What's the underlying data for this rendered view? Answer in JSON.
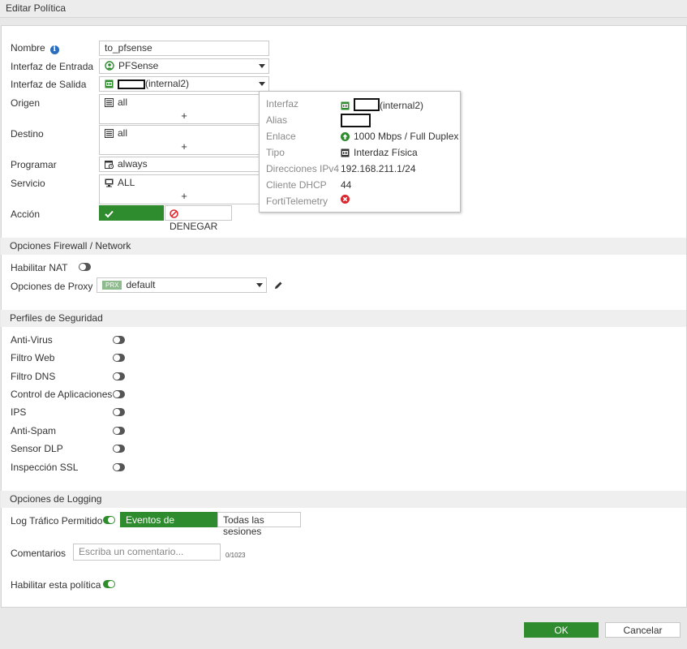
{
  "window": {
    "title": "Editar Política"
  },
  "form": {
    "name": {
      "label": "Nombre",
      "value": "to_pfsense"
    },
    "incoming_interface": {
      "label": "Interfaz de Entrada",
      "value": "PFSense"
    },
    "outgoing_interface": {
      "label": "Interfaz de Salida",
      "value": "(internal2)"
    },
    "source": {
      "label": "Origen",
      "value": "all",
      "add": "+"
    },
    "destination": {
      "label": "Destino",
      "value": "all",
      "add": "+"
    },
    "schedule": {
      "label": "Programar",
      "value": "always"
    },
    "service": {
      "label": "Servicio",
      "value": "ALL",
      "add": "+"
    },
    "action": {
      "label": "Acción",
      "accept_label": "ACEPTAR",
      "deny_label": "DENEGAR",
      "selected": "ACEPTAR"
    }
  },
  "firewall_section": {
    "title": "Opciones Firewall / Network",
    "nat_label": "Habilitar NAT",
    "nat_enabled": false,
    "proxy_label": "Opciones de Proxy",
    "proxy_badge": "PRX",
    "proxy_value": "default"
  },
  "security_section": {
    "title": "Perfiles de Seguridad",
    "profiles": [
      {
        "label": "Anti-Virus",
        "enabled": false
      },
      {
        "label": "Filtro Web",
        "enabled": false
      },
      {
        "label": "Filtro DNS",
        "enabled": false
      },
      {
        "label": "Control de Aplicaciones",
        "enabled": false
      },
      {
        "label": "IPS",
        "enabled": false
      },
      {
        "label": "Anti-Spam",
        "enabled": false
      },
      {
        "label": "Sensor DLP",
        "enabled": false
      },
      {
        "label": "Inspección SSL",
        "enabled": false
      }
    ]
  },
  "logging_section": {
    "title": "Opciones de Logging",
    "log_label": "Log Tráfico Permitido",
    "log_enabled": true,
    "security_events": "Eventos de seguridad",
    "all_sessions": "Todas las sesiones",
    "selected": "Eventos de seguridad",
    "comments_label": "Comentarios",
    "comments_placeholder": "Escriba un comentario...",
    "comments_counter": "0/1023",
    "enable_policy_label": "Habilitar esta política",
    "policy_enabled": true
  },
  "tooltip": {
    "interface_key": "Interfaz",
    "interface_value": "(internal2)",
    "alias_key": "Alias",
    "link_key": "Enlace",
    "link_value": "1000 Mbps / Full Duplex",
    "type_key": "Tipo",
    "type_value": "Interdaz Física",
    "ipv4_key": "Direcciones IPv4",
    "ipv4_value": "192.168.211.1/24",
    "dhcp_key": "Cliente DHCP",
    "dhcp_value": "44",
    "telemetry_key": "FortiTelemetry"
  },
  "footer": {
    "ok_label": "OK",
    "cancel_label": "Cancelar"
  },
  "colors": {
    "accent_green": "#2e8b2e",
    "info_blue": "#2a6ebd",
    "error_red": "#d9262c"
  }
}
